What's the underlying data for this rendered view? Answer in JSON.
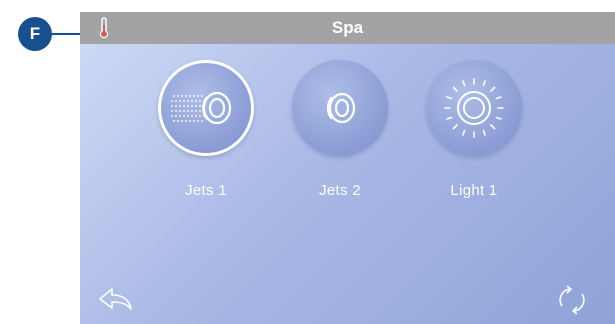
{
  "callout": {
    "label": "F",
    "color": "#17508f"
  },
  "header": {
    "title": "Spa",
    "icon": "thermometer-icon"
  },
  "buttons": [
    {
      "label": "Jets 1",
      "icon": "jets-active-icon",
      "selected": true
    },
    {
      "label": "Jets 2",
      "icon": "jets-icon",
      "selected": false
    },
    {
      "label": "Light 1",
      "icon": "light-icon",
      "selected": false
    }
  ],
  "footer": {
    "back_icon": "back-arrow-icon",
    "refresh_icon": "refresh-icon"
  },
  "colors": {
    "titlebar": "#a3a3a6",
    "accent": "#17508f",
    "background": "#aab9e6"
  }
}
